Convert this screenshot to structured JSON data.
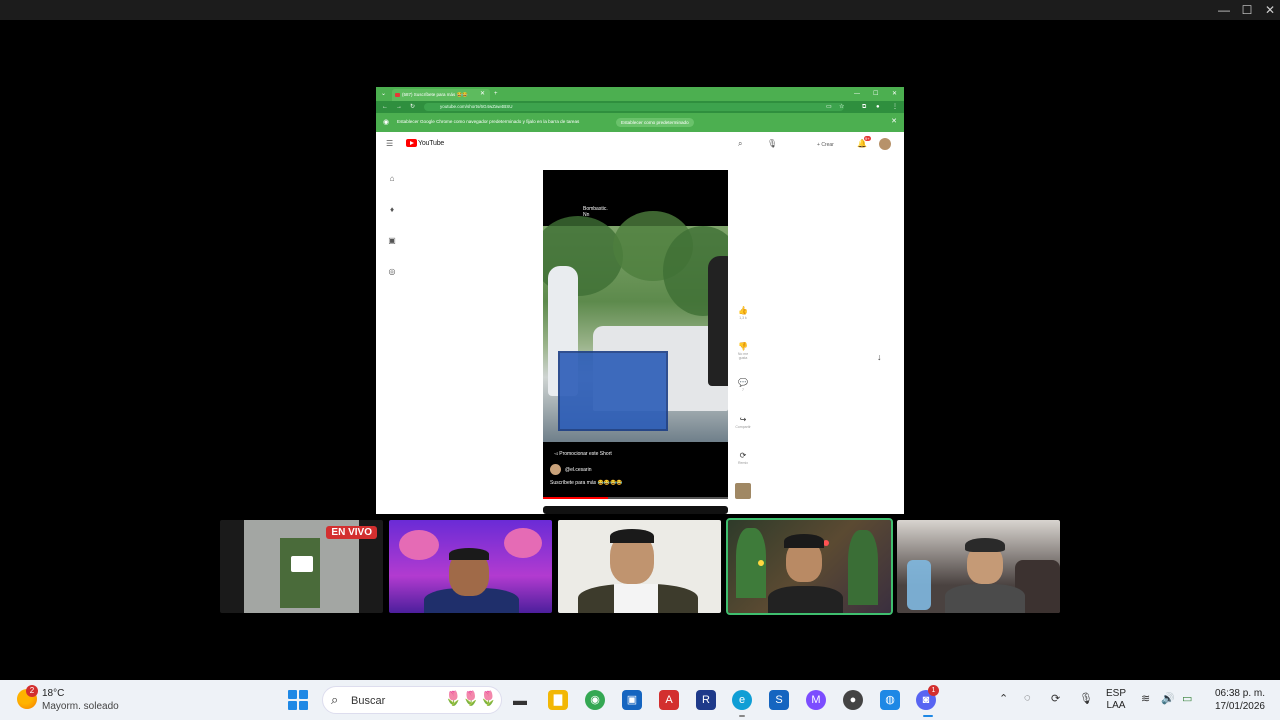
{
  "window": {
    "minimize": "—",
    "maximize": "☐",
    "close": "✕"
  },
  "browser": {
    "tab_title": "(587) Suscríbete para más 😂😂",
    "new_tab": "+",
    "url": "youtube.com/shorts/6G4wZaw4BSU",
    "infobar_text": "Establecer Google Chrome como navegador predeterminado y fijalo en la barra de tareas",
    "infobar_button": "Establecer como predeterminado",
    "infobar_close": "✕"
  },
  "youtube": {
    "logo_text": "YouTube",
    "create_label": "Crear",
    "notif_count": "9+",
    "short": {
      "top_text": "Bombastic.",
      "top_subtext": "Nn",
      "promo": "Promocionar este Short",
      "channel": "@el.cesarin",
      "caption": "Suscríbete para más 😂😂😂😂"
    },
    "actions": [
      {
        "icon": "👍",
        "label": "1,3 k"
      },
      {
        "icon": "👎",
        "label": "No me gusta"
      },
      {
        "icon": "💬",
        "label": "7"
      },
      {
        "icon": "↪",
        "label": "Compartir"
      },
      {
        "icon": "⟳",
        "label": "Remix"
      }
    ]
  },
  "call": {
    "live_badge": "EN VIVO"
  },
  "taskbar": {
    "weather_badge": "2",
    "temperature": "18°C",
    "condition": "Mayorm. soleado",
    "search_placeholder": "Buscar",
    "lang_line1": "ESP",
    "lang_line2": "LAA",
    "time": "06:38 p. m.",
    "date": "17/01/2026",
    "discord_badge": "1",
    "apps": [
      {
        "name": "file-explorer",
        "glyph": "▬",
        "color": "#333333"
      },
      {
        "name": "folder",
        "glyph": "▇",
        "color": "#f2b705"
      },
      {
        "name": "chrome",
        "glyph": "◉",
        "color": "#34a853"
      },
      {
        "name": "store",
        "glyph": "▣",
        "color": "#1565c0"
      },
      {
        "name": "adobe",
        "glyph": "A",
        "color": "#d32f2f"
      },
      {
        "name": "revit",
        "glyph": "R",
        "color": "#1e3a8a"
      },
      {
        "name": "edge",
        "glyph": "e",
        "color": "#0f9ed5"
      },
      {
        "name": "sketchup",
        "glyph": "S",
        "color": "#1565c0"
      },
      {
        "name": "messenger",
        "glyph": "M",
        "color": "#7c4dff"
      },
      {
        "name": "davinci",
        "glyph": "●",
        "color": "#444444"
      },
      {
        "name": "app-blue",
        "glyph": "◍",
        "color": "#1e88e5"
      },
      {
        "name": "discord",
        "glyph": "◙",
        "color": "#5865f2"
      }
    ]
  }
}
